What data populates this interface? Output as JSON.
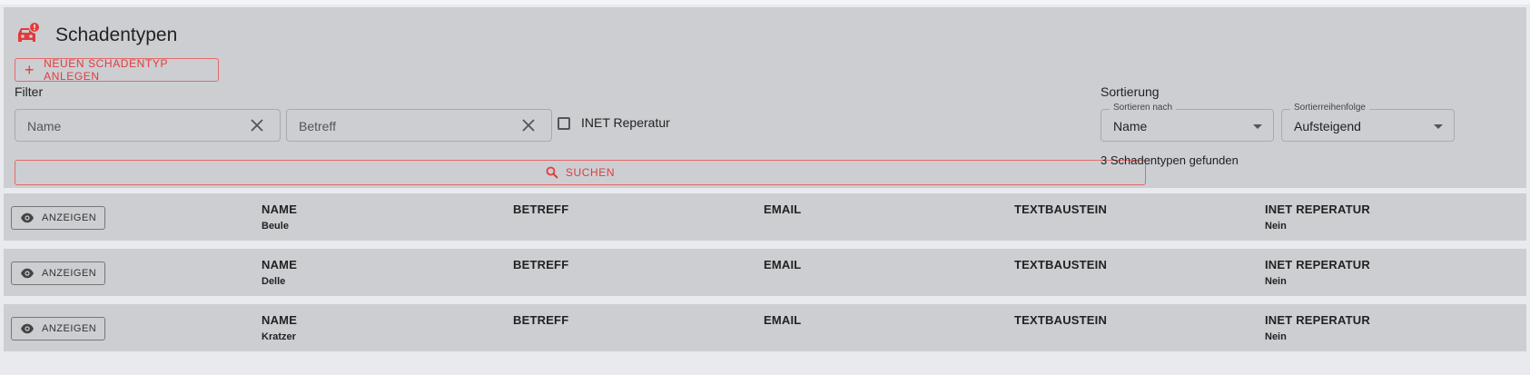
{
  "page": {
    "title": "Schadentypen",
    "new_button_label": "NEUEN SCHADENTYP ANLEGEN",
    "accent_color": "#e23b3b"
  },
  "filter": {
    "label": "Filter",
    "name_placeholder": "Name",
    "betreff_placeholder": "Betreff",
    "inet_checkbox_label": "INET Reperatur",
    "inet_checked": false,
    "search_button_label": "SUCHEN"
  },
  "sort": {
    "label": "Sortierung",
    "sort_by_legend": "Sortieren nach",
    "sort_by_value": "Name",
    "order_legend": "Sortierreihenfolge",
    "order_value": "Aufsteigend"
  },
  "results": {
    "count_text": "3 Schadentypen gefunden",
    "show_button_label": "ANZEIGEN",
    "columns": {
      "name": "NAME",
      "betreff": "BETREFF",
      "email": "EMAIL",
      "textbaustein": "TEXTBAUSTEIN",
      "inet": "INET REPERATUR"
    },
    "rows": [
      {
        "name": "Beule",
        "betreff": "",
        "email": "",
        "textbaustein": "",
        "inet": "Nein"
      },
      {
        "name": "Delle",
        "betreff": "",
        "email": "",
        "textbaustein": "",
        "inet": "Nein"
      },
      {
        "name": "Kratzer",
        "betreff": "",
        "email": "",
        "textbaustein": "",
        "inet": "Nein"
      }
    ]
  },
  "icons": {
    "title": "car-damage-icon",
    "add": "plus-icon",
    "clear": "close-icon",
    "search": "search-icon",
    "show": "eye-icon",
    "dropdown": "caret-down-icon"
  }
}
